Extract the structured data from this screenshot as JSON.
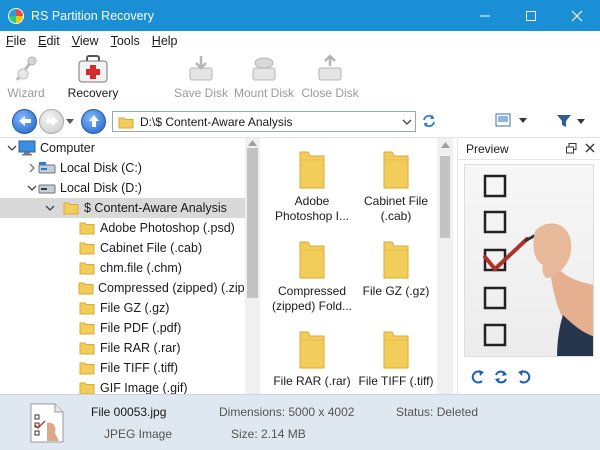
{
  "window": {
    "title": "RS Partition Recovery"
  },
  "menu": [
    {
      "label": "File",
      "key": "F",
      "rest": "ile"
    },
    {
      "label": "Edit",
      "key": "E",
      "rest": "dit"
    },
    {
      "label": "View",
      "key": "V",
      "rest": "iew"
    },
    {
      "label": "Tools",
      "key": "T",
      "rest": "ools"
    },
    {
      "label": "Help",
      "key": "H",
      "rest": "elp"
    }
  ],
  "toolbar": {
    "wizard": "Wizard",
    "recovery": "Recovery",
    "save_disk": "Save Disk",
    "mount_disk": "Mount Disk",
    "close_disk": "Close Disk"
  },
  "address": {
    "path": "D:\\$ Content-Aware Analysis"
  },
  "tree": [
    {
      "label": "Computer",
      "level": 0,
      "state": "expanded",
      "icon": "computer-icon"
    },
    {
      "label": "Local Disk (C:)",
      "level": 1,
      "state": "collapsed",
      "icon": "disk-icon"
    },
    {
      "label": "Local Disk (D:)",
      "level": 1,
      "state": "expanded",
      "icon": "disk-icon"
    },
    {
      "label": "$ Content-Aware Analysis",
      "level": 2,
      "state": "expanded",
      "icon": "folder-icon",
      "selected": true
    },
    {
      "label": "Adobe Photoshop (.psd)",
      "level": 3,
      "icon": "folder-icon"
    },
    {
      "label": "Cabinet File (.cab)",
      "level": 3,
      "icon": "folder-icon"
    },
    {
      "label": "chm.file (.chm)",
      "level": 3,
      "icon": "folder-icon"
    },
    {
      "label": "Compressed (zipped) (.zip)",
      "level": 3,
      "icon": "folder-icon"
    },
    {
      "label": "File GZ (.gz)",
      "level": 3,
      "icon": "folder-icon"
    },
    {
      "label": "File PDF (.pdf)",
      "level": 3,
      "icon": "folder-icon"
    },
    {
      "label": "File RAR (.rar)",
      "level": 3,
      "icon": "folder-icon"
    },
    {
      "label": "File TIFF (.tiff)",
      "level": 3,
      "icon": "folder-icon"
    },
    {
      "label": "GIF Image (.gif)",
      "level": 3,
      "icon": "folder-icon"
    }
  ],
  "files": [
    {
      "line1": "Adobe",
      "line2": "Photoshop I..."
    },
    {
      "line1": "Cabinet File",
      "line2": "(.cab)"
    },
    {
      "line1": "Compressed",
      "line2": "(zipped) Fold..."
    },
    {
      "line1": "File GZ (.gz)",
      "line2": ""
    },
    {
      "line1": "File RAR (.rar)",
      "line2": ""
    },
    {
      "line1": "File TIFF (.tiff)",
      "line2": ""
    }
  ],
  "preview": {
    "title": "Preview"
  },
  "status": {
    "file_name": "File 00053.jpg",
    "file_type": "JPEG Image",
    "dimensions": "Dimensions: 5000 x 4002",
    "size": "Size: 2.14 MB",
    "status": "Status: Deleted"
  },
  "colors": {
    "titlebar": "#1a8fd6",
    "folder": "#f3cd5c",
    "selection": "#d9d9d9",
    "statusbar": "#dfe7f0",
    "checkmark": "#b0302a"
  }
}
